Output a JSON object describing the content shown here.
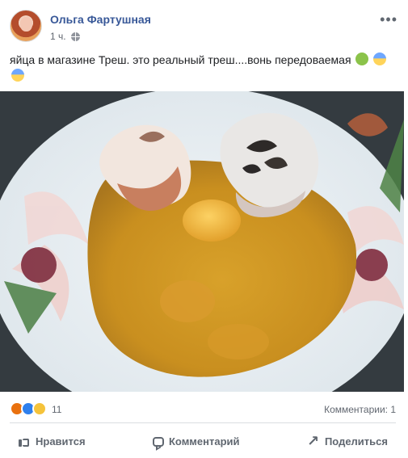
{
  "post": {
    "author": "Ольга Фартушная",
    "time": "1 ч.",
    "text": "яйца в магазине Треш. это реальный треш....вонь передоваемая",
    "menu_icon": "more-horizontal-icon"
  },
  "reactions": {
    "count": "11",
    "comments": "Комментарии: 1",
    "types": [
      "angry",
      "like",
      "wow"
    ]
  },
  "actions": {
    "like": "Нравится",
    "comment": "Комментарий",
    "share": "Поделиться"
  },
  "colors": {
    "author": "#385898",
    "secondary_text": "#616770",
    "divider": "#dadde1"
  }
}
